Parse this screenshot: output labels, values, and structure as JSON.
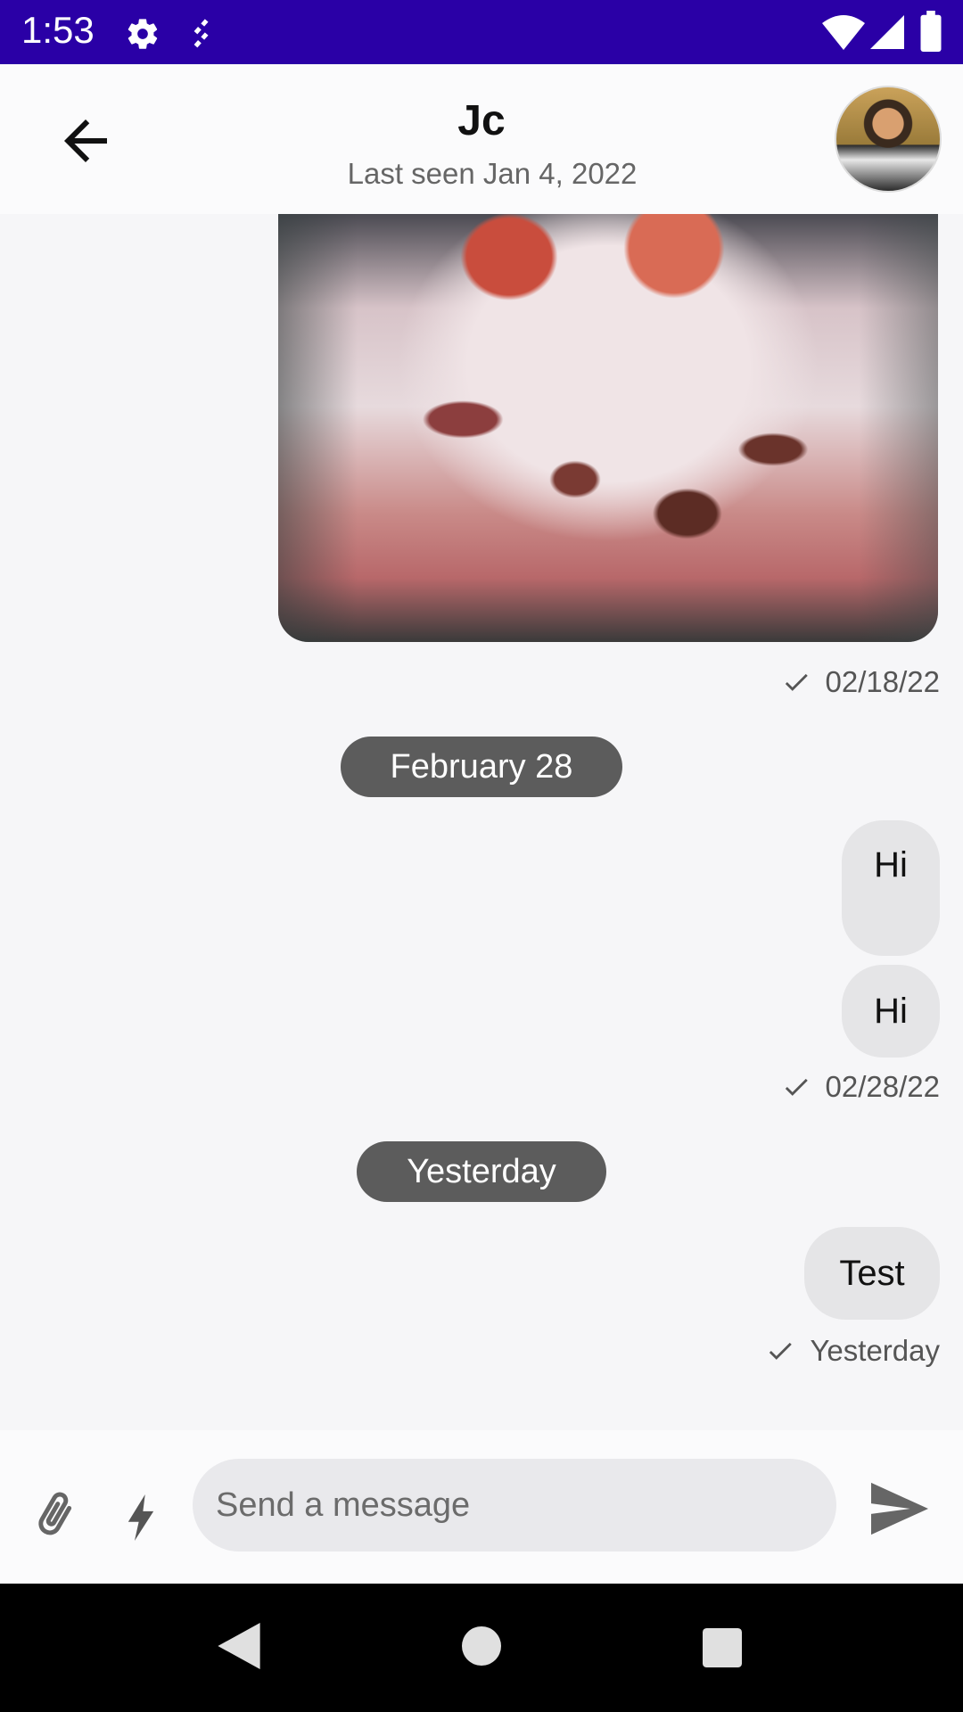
{
  "status_bar": {
    "time": "1:53",
    "icons": [
      "gear-icon",
      "sync-icon",
      "wifi-icon",
      "signal-icon",
      "battery-icon"
    ],
    "background": "#2a00a6"
  },
  "header": {
    "title": "Jc",
    "subtitle": "Last seen Jan 4, 2022",
    "back_icon": "arrow-back-icon",
    "avatar": "contact-avatar"
  },
  "messages": [
    {
      "type": "image",
      "description_icon": "dessert-photo",
      "meta": "02/18/22",
      "status": "sent-check-icon"
    },
    {
      "type": "date_chip",
      "label": "February 28"
    },
    {
      "type": "text",
      "text": "Hi"
    },
    {
      "type": "text",
      "text": "Hi",
      "meta": "02/28/22",
      "status": "sent-check-icon"
    },
    {
      "type": "date_chip",
      "label": "Yesterday"
    },
    {
      "type": "text",
      "text": "Test",
      "meta": "Yesterday",
      "status": "sent-check-icon"
    }
  ],
  "composer": {
    "placeholder": "Send a message",
    "value": "",
    "attach_icon": "paperclip-icon",
    "bolt_icon": "lightning-icon",
    "send_icon": "send-icon"
  },
  "nav_bar": {
    "icons": [
      "back-triangle-icon",
      "home-circle-icon",
      "recents-square-icon"
    ]
  }
}
